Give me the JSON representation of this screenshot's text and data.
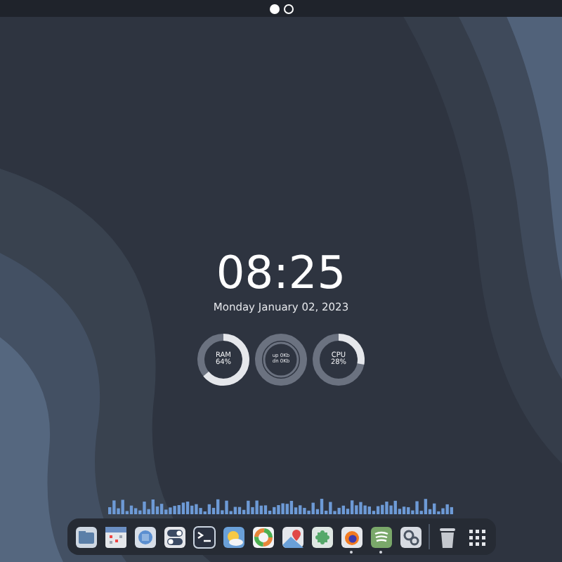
{
  "top_bar": {
    "pages": [
      {
        "selected": true
      },
      {
        "selected": false
      }
    ]
  },
  "clock": {
    "time": "08:25",
    "date": "Monday January 02, 2023"
  },
  "gauges": [
    {
      "kind": "ring",
      "lines": [
        "RAM",
        "64%"
      ],
      "level": 0.64
    },
    {
      "kind": "network",
      "lines": [
        "up 0Kb",
        "dn 0Kb"
      ]
    },
    {
      "kind": "ring",
      "lines": [
        "CPU",
        "28%"
      ],
      "level": 0.28
    }
  ],
  "dock": {
    "apps": [
      {
        "kind": "folder",
        "running": false
      },
      {
        "kind": "calendar",
        "running": false
      },
      {
        "kind": "disc",
        "running": false
      },
      {
        "kind": "toggles",
        "running": false
      },
      {
        "kind": "terminal",
        "running": false
      },
      {
        "kind": "weather",
        "running": false
      },
      {
        "kind": "palette",
        "running": false
      },
      {
        "kind": "map",
        "running": false
      },
      {
        "kind": "puzzle",
        "running": false
      },
      {
        "kind": "firefox",
        "running": true
      },
      {
        "kind": "spotify",
        "running": true
      },
      {
        "kind": "gears",
        "running": false
      },
      {
        "kind": "trash",
        "running": false
      },
      {
        "kind": "grid",
        "running": false
      }
    ]
  }
}
